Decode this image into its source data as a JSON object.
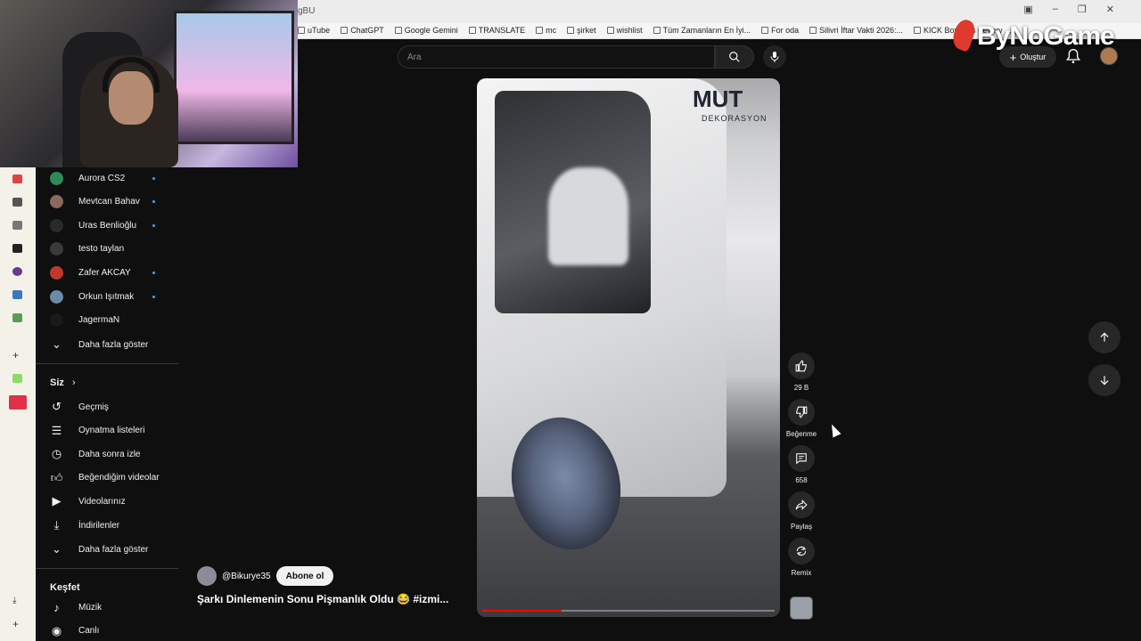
{
  "browser": {
    "tab_title": "gBU",
    "bookmarks": [
      "uTube",
      "ChatGPT",
      "Google Gemini",
      "TRANSLATE",
      "mc",
      "şirket",
      "wishlist",
      "Tüm Zamanların En İyi...",
      "For oda",
      "Silivri İftar Vakti 2026:...",
      "KICK Bounties - every ..."
    ]
  },
  "overlay": {
    "logo_text": "ByNoGame"
  },
  "header": {
    "search_placeholder": "Ara",
    "create_label": "Oluştur"
  },
  "sidebar": {
    "subscriptions": [
      {
        "name": "Aurora CS2",
        "new": true,
        "color": "#2e8b57"
      },
      {
        "name": "Mevtcan Bahav",
        "new": true,
        "color": "#8a6a5a"
      },
      {
        "name": "Uras Benlioğlu",
        "new": true,
        "color": "#2a2a2a"
      },
      {
        "name": "testo taylan",
        "new": false,
        "color": "#3a3a3a"
      },
      {
        "name": "Zafer AKCAY",
        "new": true,
        "color": "#c0392b"
      },
      {
        "name": "Orkun Işıtmak",
        "new": true,
        "color": "#6a8aa8"
      },
      {
        "name": "JagermaN",
        "new": false,
        "color": "#1a1a1a"
      }
    ],
    "show_more_1": "Daha fazla göster",
    "you_header": "Siz",
    "you_items": [
      {
        "label": "Geçmiş",
        "icon": "history-icon"
      },
      {
        "label": "Oynatma listeleri",
        "icon": "playlists-icon"
      },
      {
        "label": "Daha sonra izle",
        "icon": "watch-later-icon"
      },
      {
        "label": "Beğendiğim videolar",
        "icon": "liked-videos-icon"
      },
      {
        "label": "Videolarınız",
        "icon": "your-videos-icon"
      },
      {
        "label": "İndirilenler",
        "icon": "downloads-icon"
      }
    ],
    "show_more_2": "Daha fazla göster",
    "explore_header": "Keşfet",
    "explore_items": [
      {
        "label": "Müzik",
        "icon": "music-icon"
      },
      {
        "label": "Canlı",
        "icon": "live-icon"
      }
    ]
  },
  "video": {
    "channel_handle": "@Bikurye35",
    "subscribe_label": "Abone ol",
    "title": "Şarkı Dinlemenin Sonu Pişmanlık Oldu 😂 #izmi...",
    "sign_text": "MUT",
    "sign_subtext": "DEKORASYON",
    "progress": 0.27
  },
  "actions": {
    "like_count": "29 B",
    "dislike_label": "Beğenme",
    "comment_count": "658",
    "share_label": "Paylaş",
    "remix_label": "Remix"
  },
  "colors": {
    "accent_red": "#ff0000",
    "background": "#0f0f0f",
    "new_dot": "#3ea6ff"
  }
}
